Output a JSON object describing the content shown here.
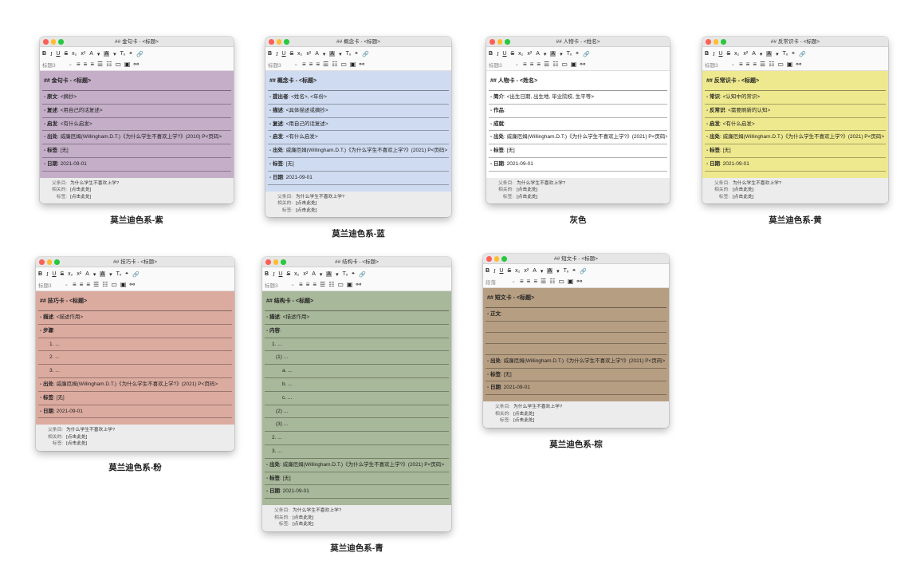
{
  "toolbar": {
    "row1": [
      "B",
      "I",
      "U",
      "S",
      "x₂",
      "x²",
      "A",
      "▾",
      "A",
      "▾",
      "Tₓ",
      "❝",
      "🔗"
    ],
    "row2_select": "标题3",
    "row2_select_brown": "段落"
  },
  "meta_labels": {
    "parent": "父条目:",
    "related": "相关的:",
    "tags": "标签:"
  },
  "meta_values": {
    "parent": "为什么学生不喜欢上学?",
    "related": "[点击此处]",
    "tags": "[点击此处]"
  },
  "cards": [
    {
      "title": "## 金句卡 - <标题>",
      "caption": "莫兰迪色系-紫",
      "color": "#c4aec8",
      "lines": [
        {
          "k": "## 金句卡 - <标题>",
          "v": "",
          "cls": "head"
        },
        {
          "k": "- 原文",
          "v": ": <摘抄>"
        },
        {
          "k": "- 复述",
          "v": ": <用自己的话复述>"
        },
        {
          "k": "- 启发",
          "v": ": <有什么启发>"
        },
        {
          "k": "- 出处",
          "v": ": 威廉厄姆(Willingham.D.T.)《为什么学生不喜欢上学?》(2010) P<页码>"
        },
        {
          "k": "- 标签",
          "v": ": [无]"
        },
        {
          "k": "- 日期",
          "v": ": 2021-09-01"
        }
      ]
    },
    {
      "title": "## 概念卡 - <标题>",
      "caption": "莫兰迪色系-蓝",
      "color": "#cfdbf0",
      "lines": [
        {
          "k": "## 概念卡 - <标题>",
          "v": "",
          "cls": "head"
        },
        {
          "k": "- 提出者",
          "v": ": <姓名>, <年份>"
        },
        {
          "k": "- 描述",
          "v": ": <具体描述或摘抄>"
        },
        {
          "k": "- 复述",
          "v": ": <用自己的话复述>"
        },
        {
          "k": "- 启发",
          "v": ": <有什么启发>"
        },
        {
          "k": "- 出处",
          "v": ": 威廉厄姆(Willingham.D.T.)《为什么学生不喜欢上学?》(2021) P<页码>"
        },
        {
          "k": "- 标签",
          "v": ": [无]"
        },
        {
          "k": "- 日期",
          "v": ": 2021-09-01"
        }
      ]
    },
    {
      "title": "## 人物卡 - <姓名>",
      "caption": "灰色",
      "color": "#ffffff",
      "lines": [
        {
          "k": "## 人物卡 - <姓名>",
          "v": "",
          "cls": "head"
        },
        {
          "k": "- 简介",
          "v": ": <出生日期, 出生地, 毕业院校, 生平等>"
        },
        {
          "k": "- 作品",
          "v": ":"
        },
        {
          "k": "- 成就",
          "v": ":"
        },
        {
          "k": "- 出处",
          "v": ": 威廉厄姆(Willingham.D.T.)《为什么学生不喜欢上学?》(2021) P<页码>"
        },
        {
          "k": "- 标签",
          "v": ": [无]"
        },
        {
          "k": "- 日期",
          "v": ": 2021-09-01"
        }
      ]
    },
    {
      "title": "## 反常识卡 - <标题>",
      "caption": "莫兰迪色系-黄",
      "color": "#eee98e",
      "lines": [
        {
          "k": "## 反常识卡 - <标题>",
          "v": "",
          "cls": "head"
        },
        {
          "k": "- 常识",
          "v": ": <认知中的常识>"
        },
        {
          "k": "- 反常识",
          "v": ": <需要刷新的认知>"
        },
        {
          "k": "- 启发",
          "v": ": <有什么启发>"
        },
        {
          "k": "- 出处",
          "v": ": 威廉厄姆(Willingham.D.T.)《为什么学生不喜欢上学?》(2021) P<页码>"
        },
        {
          "k": "- 标签",
          "v": ": [无]"
        },
        {
          "k": "- 日期",
          "v": ": 2021-09-01"
        }
      ]
    },
    {
      "title": "## 技巧卡 - <标题>",
      "caption": "莫兰迪色系-粉",
      "color": "#dcaba0",
      "lines": [
        {
          "k": "## 技巧卡 - <标题>",
          "v": "",
          "cls": "head"
        },
        {
          "k": "- 描述",
          "v": ": <描述作用>"
        },
        {
          "k": "- 步骤",
          "v": ":"
        },
        {
          "k": "",
          "v": "1. ...",
          "cls": "ind2"
        },
        {
          "k": "",
          "v": "2. ...",
          "cls": "ind2"
        },
        {
          "k": "",
          "v": "3. ...",
          "cls": "ind2"
        },
        {
          "k": "- 出处",
          "v": ": 威廉厄姆(Willingham.D.T.)《为什么学生不喜欢上学?》(2021) P<页码>"
        },
        {
          "k": "- 标签",
          "v": ": [无]"
        },
        {
          "k": "- 日期",
          "v": ": 2021-09-01"
        }
      ]
    },
    {
      "title": "## 结构卡 - <标题>",
      "caption": "莫兰迪色系-青",
      "color": "#a8b89a",
      "lines": [
        {
          "k": "## 结构卡 - <标题>",
          "v": "",
          "cls": "head"
        },
        {
          "k": "- 描述",
          "v": ": <描述作用>"
        },
        {
          "k": "- 内容",
          "v": ":"
        },
        {
          "k": "",
          "v": "1. ...",
          "cls": "ind1"
        },
        {
          "k": "",
          "v": "(1) ...",
          "cls": "ind2"
        },
        {
          "k": "",
          "v": "a. ...",
          "cls": "ind3"
        },
        {
          "k": "",
          "v": "b. ...",
          "cls": "ind3"
        },
        {
          "k": "",
          "v": "c. ...",
          "cls": "ind3"
        },
        {
          "k": "",
          "v": "(2) ...",
          "cls": "ind2"
        },
        {
          "k": "",
          "v": "(3) ...",
          "cls": "ind2"
        },
        {
          "k": "",
          "v": "2. ...",
          "cls": "ind1"
        },
        {
          "k": "",
          "v": "3. ...",
          "cls": "ind1"
        },
        {
          "k": "- 出处",
          "v": ": 威廉厄姆(Willingham.D.T.)《为什么学生不喜欢上学?》(2021) P<页码>"
        },
        {
          "k": "- 标签",
          "v": ": [无]"
        },
        {
          "k": "- 日期",
          "v": ": 2021-09-01"
        }
      ]
    },
    {
      "title": "## 短文卡 - <标题>",
      "caption": "莫兰迪色系-棕",
      "color": "#b69e82",
      "lines": [
        {
          "k": "## 短文卡 - <标题>",
          "v": "",
          "cls": "head"
        },
        {
          "k": "- 正文",
          "v": ":"
        },
        {
          "k": "",
          "v": "",
          "cls": "blank"
        },
        {
          "k": "",
          "v": "",
          "cls": "blank"
        },
        {
          "k": "",
          "v": "",
          "cls": "blank"
        },
        {
          "k": "- 出处",
          "v": ": 威廉厄姆(Willingham.D.T.)《为什么学生不喜欢上学?》(2021) P<页码>"
        },
        {
          "k": "- 标签",
          "v": ": [无]"
        },
        {
          "k": "- 日期",
          "v": ": 2021-09-01"
        }
      ]
    }
  ]
}
